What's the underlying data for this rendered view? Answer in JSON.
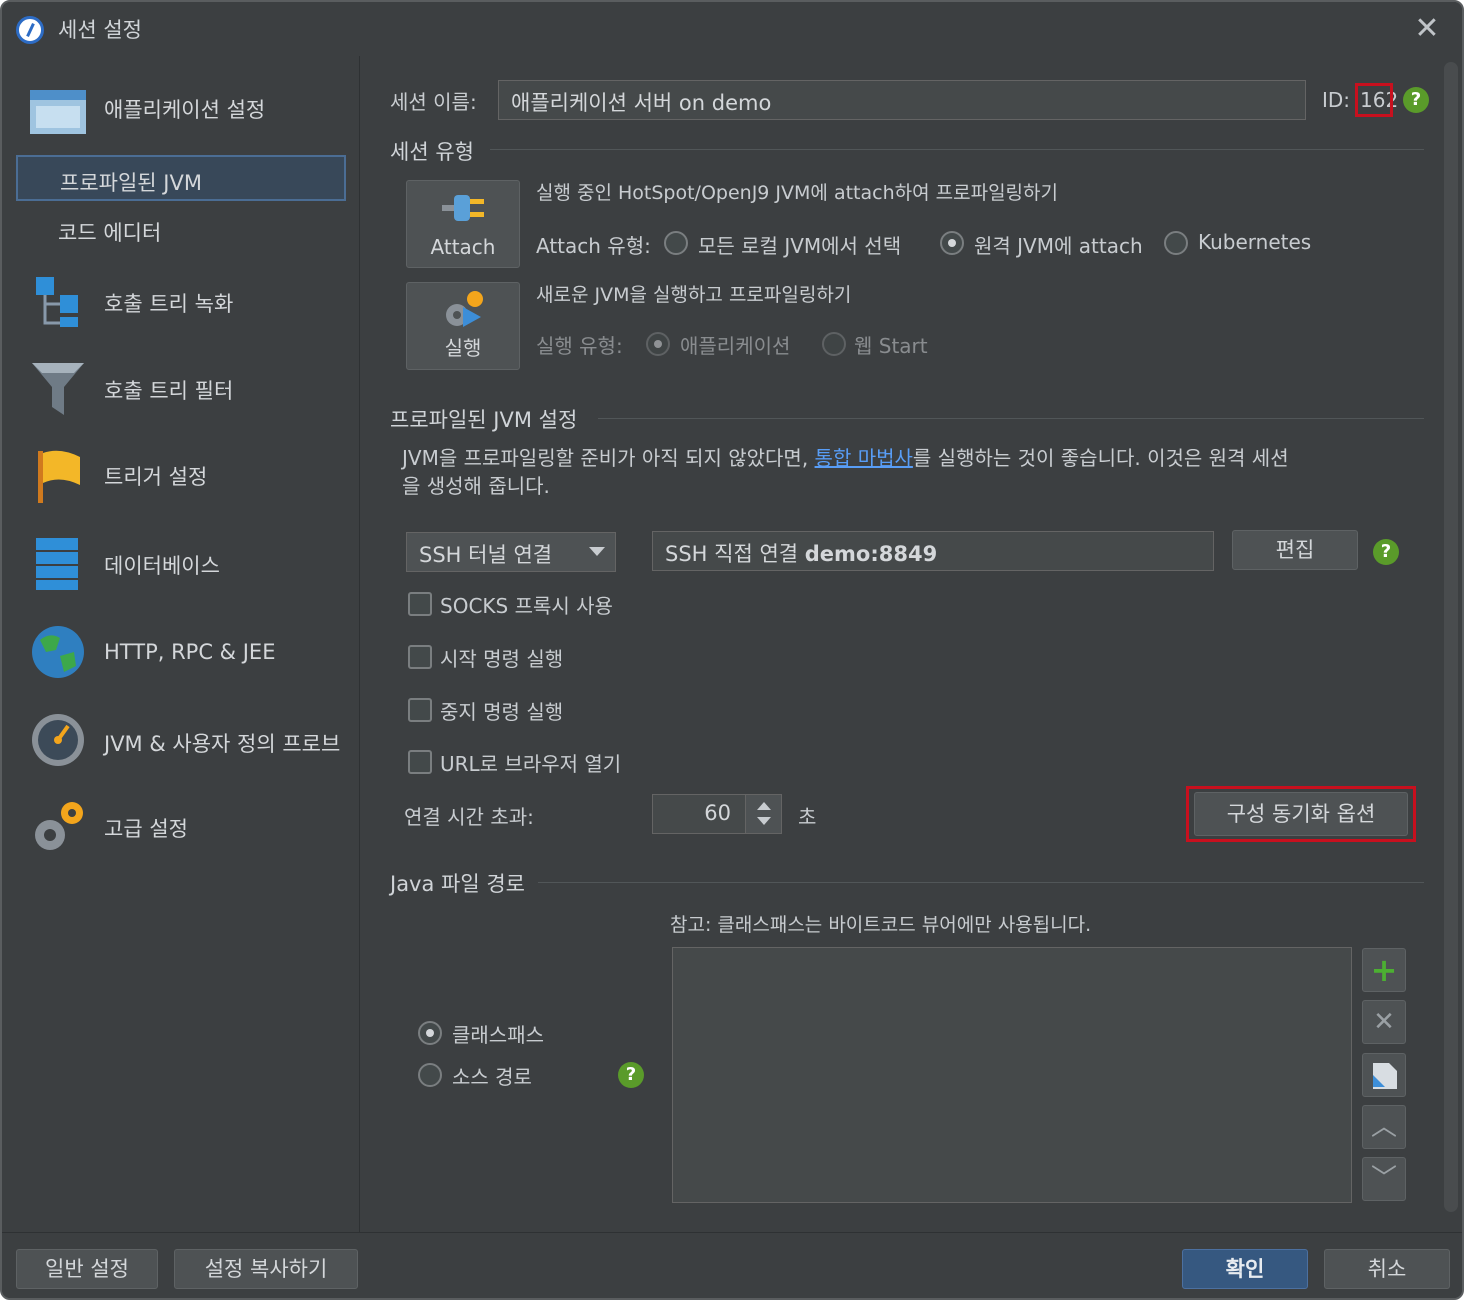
{
  "window": {
    "title": "세션 설정"
  },
  "sidebar": {
    "items": [
      {
        "label": "애플리케이션 설정",
        "icon": "app-window-icon"
      },
      {
        "label": "프로파일된 JVM"
      },
      {
        "label": "코드 에디터"
      },
      {
        "label": "호출 트리 녹화",
        "icon": "call-tree-record-icon"
      },
      {
        "label": "호출 트리 필터",
        "icon": "filter-icon"
      },
      {
        "label": "트리거 설정",
        "icon": "flag-icon"
      },
      {
        "label": "데이터베이스",
        "icon": "database-icon"
      },
      {
        "label": "HTTP, RPC & JEE",
        "icon": "globe-icon"
      },
      {
        "label": "JVM & 사용자 정의 프로브",
        "icon": "gauge-icon"
      },
      {
        "label": "고급 설정",
        "icon": "gears-icon"
      }
    ]
  },
  "session": {
    "name_label": "세션 이름:",
    "name_value": "애플리케이션 서버 on demo",
    "id_label": "ID:",
    "id_value": "162"
  },
  "session_type": {
    "header": "세션 유형",
    "attach_button": "Attach",
    "attach_desc": "실행 중인 HotSpot/OpenJ9 JVM에 attach하여 프로파일링하기",
    "attach_type_label": "Attach 유형:",
    "attach_options": [
      "모든 로컬 JVM에서 선택",
      "원격 JVM에 attach",
      "Kubernetes"
    ],
    "attach_selected": 1,
    "run_button": "실행",
    "run_desc": "새로운 JVM을 실행하고 프로파일링하기",
    "run_type_label": "실행 유형:",
    "run_options": [
      "애플리케이션",
      "웹 Start"
    ]
  },
  "profiled_jvm": {
    "header": "프로파일된 JVM 설정",
    "desc_before": "JVM을 프로파일링할 준비가 아직 되지 않았다면, ",
    "desc_link": "통합 마법사",
    "desc_after": "를 실행하는 것이 좋습니다. 이것은 원격 세션",
    "desc_line2": "을 생성해 줍니다.",
    "connection_select": "SSH 터널 연결",
    "connection_value_prefix": "SSH 직접 연결 ",
    "connection_value_bold": "demo:8849",
    "edit_button": "편집",
    "checkboxes": [
      "SOCKS 프록시 사용",
      "시작 명령 실행",
      "중지 명령 실행",
      "URL로 브라우저 열기"
    ],
    "timeout_label": "연결 시간 초과:",
    "timeout_value": "60",
    "timeout_unit": "초",
    "sync_button": "구성 동기화 옵션"
  },
  "java_path": {
    "header": "Java 파일 경로",
    "note": "참고: 클래스패스는 바이트코드 뷰어에만 사용됩니다.",
    "options": [
      "클래스패스",
      "소스 경로"
    ],
    "selected": 0
  },
  "footer": {
    "general_button": "일반 설정",
    "copy_button": "설정 복사하기",
    "ok_button": "확인",
    "cancel_button": "취소"
  },
  "colors": {
    "background": "#3c3f41",
    "accent": "#365880",
    "highlight": "#c8101e",
    "help": "#5a9b2a",
    "link": "#589df6"
  }
}
